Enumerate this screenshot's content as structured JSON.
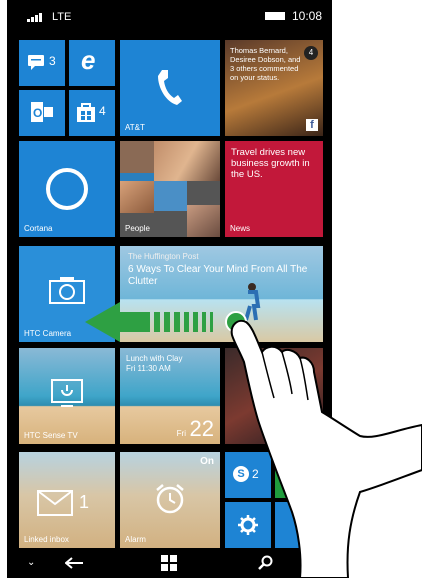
{
  "status": {
    "network": "LTE",
    "time": "10:08"
  },
  "tiles": {
    "messaging_count": "3",
    "store_count": "4",
    "phone_label": "AT&T",
    "facebook_text": "Thomas Bernard, Desiree Dobson, and 3 others commented on your status.",
    "facebook_count": "4",
    "cortana_label": "Cortana",
    "people_label": "People",
    "news_text": "Travel drives new business growth in the US.",
    "news_label": "News",
    "camera_label": "HTC Camera",
    "huff_source": "The Huffington Post",
    "huff_title": "6 Ways To Clear Your Mind From All The Clutter",
    "sense_tv_label": "HTC Sense TV",
    "calendar_text": "Lunch with Clay\nFri 11:30 AM",
    "calendar_day": "Fri",
    "calendar_date": "22",
    "email_count": "1",
    "email_label": "Linked inbox",
    "alarm_on": "On",
    "alarm_label": "Alarm",
    "skype_count": "2"
  },
  "colors": {
    "tile_blue": "#1e84d4",
    "tile_red": "#c2183a",
    "arrow_green": "#2ea043"
  }
}
